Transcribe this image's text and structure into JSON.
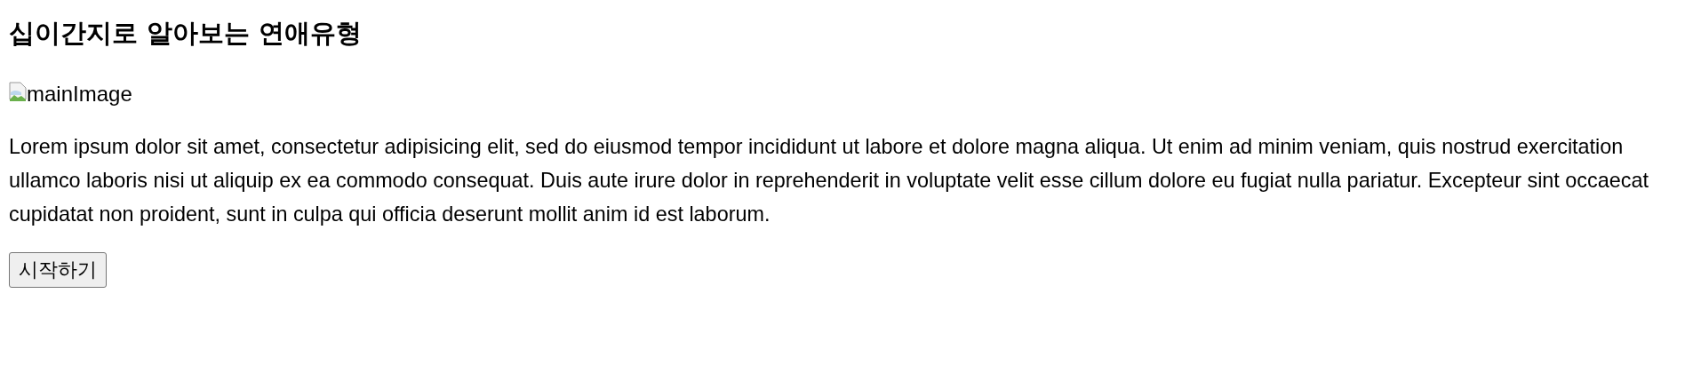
{
  "title": "십이간지로 알아보는 연애유형",
  "image": {
    "alt": "mainImage"
  },
  "paragraph": "Lorem ipsum dolor sit amet, consectetur adipisicing elit, sed do eiusmod tempor incididunt ut labore et dolore magna aliqua. Ut enim ad minim veniam, quis nostrud exercitation ullamco laboris nisi ut aliquip ex ea commodo consequat. Duis aute irure dolor in reprehenderit in voluptate velit esse cillum dolore eu fugiat nulla pariatur. Excepteur sint occaecat cupidatat non proident, sunt in culpa qui officia deserunt mollit anim id est laborum.",
  "button": "시작하기"
}
